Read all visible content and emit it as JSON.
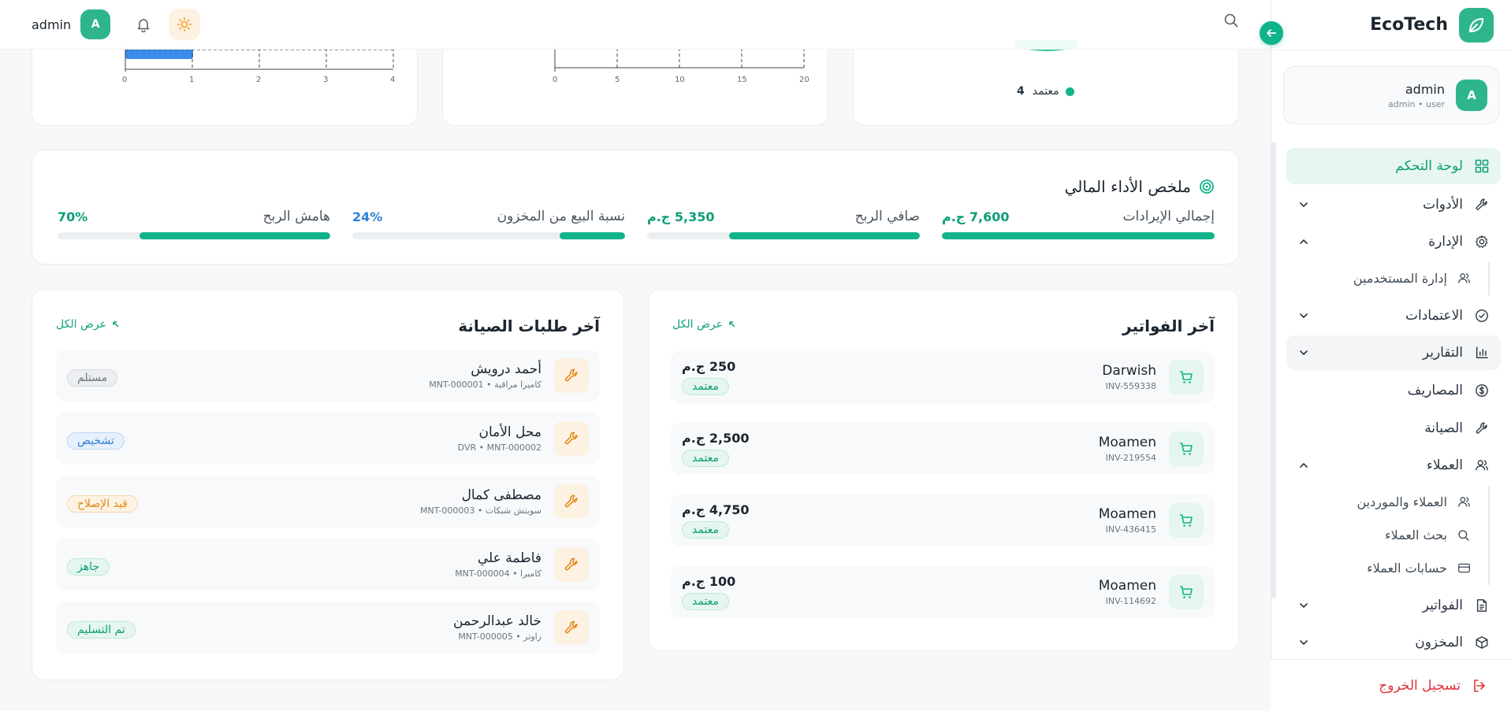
{
  "brand": {
    "name": "EcoTech"
  },
  "colors": {
    "accent": "#10b38a",
    "danger": "#e0333a",
    "blue": "#2f7fd8",
    "orange": "#e08a17"
  },
  "user": {
    "name": "admin",
    "role": "admin • user",
    "initial": "A"
  },
  "topbar": {
    "username": "admin",
    "initial": "A"
  },
  "sidebar": {
    "items": [
      {
        "label": "لوحة التحكم",
        "icon": "dashboard-icon"
      },
      {
        "label": "الأدوات",
        "icon": "wrench-icon"
      },
      {
        "label": "الإدارة",
        "icon": "gear-icon"
      },
      {
        "label": "إدارة المستخدمين",
        "icon": "users-icon"
      },
      {
        "label": "الاعتمادات",
        "icon": "check-circle-icon"
      },
      {
        "label": "التقارير",
        "icon": "bar-chart-icon"
      },
      {
        "label": "المصاريف",
        "icon": "dollar-icon"
      },
      {
        "label": "الصيانة",
        "icon": "wrench-icon"
      },
      {
        "label": "العملاء",
        "icon": "users-icon"
      },
      {
        "label": "العملاء والموردين",
        "icon": "users-icon"
      },
      {
        "label": "بحث العملاء",
        "icon": "search-icon"
      },
      {
        "label": "حسابات العملاء",
        "icon": "card-icon"
      },
      {
        "label": "الفواتير",
        "icon": "invoice-icon"
      },
      {
        "label": "المخزون",
        "icon": "box-icon"
      }
    ],
    "logout": "تسجيل الخروج"
  },
  "top_cards": {
    "chart1_ticks": [
      "0",
      "1",
      "2",
      "3",
      "4"
    ],
    "chart2_ticks": [
      "0",
      "5",
      "10",
      "15",
      "20"
    ],
    "legend": {
      "label": "معتمد",
      "value": "4"
    }
  },
  "financial": {
    "title": "ملخص الأداء المالي",
    "metrics": [
      {
        "label": "إجمالي الإيرادات",
        "value": "7,600 ج.م",
        "fill": 1.0,
        "color": "#10b38a"
      },
      {
        "label": "صافي الربح",
        "value": "5,350 ج.م",
        "fill": 0.7,
        "color": "#10b38a"
      },
      {
        "label": "نسبة البيع من المخزون",
        "value": "24%",
        "fill": 0.24,
        "color": "#10b38a"
      },
      {
        "label": "هامش الربح",
        "value": "70%",
        "fill": 0.7,
        "color": "#10b38a"
      }
    ]
  },
  "invoices": {
    "title": "آخر الفواتير",
    "view_all": "عرض الكل",
    "rows": [
      {
        "name": "Darwish",
        "id": "INV-559338",
        "amount": "250 ج.م",
        "status": "معتمد"
      },
      {
        "name": "Moamen",
        "id": "INV-219554",
        "amount": "2,500 ج.م",
        "status": "معتمد"
      },
      {
        "name": "Moamen",
        "id": "INV-436415",
        "amount": "4,750 ج.م",
        "status": "معتمد"
      },
      {
        "name": "Moamen",
        "id": "INV-114692",
        "amount": "100 ج.م",
        "status": "معتمد"
      }
    ]
  },
  "maintenance": {
    "title": "آخر طلبات الصيانة",
    "view_all": "عرض الكل",
    "rows": [
      {
        "name": "أحمد درويش",
        "sub": "كاميرا مراقبة • MNT-000001",
        "status": "مستلم"
      },
      {
        "name": "محل الأمان",
        "sub": "DVR • MNT-000002",
        "status": "تشخيص"
      },
      {
        "name": "مصطفى كمال",
        "sub": "سويتش شبكات • MNT-000003",
        "status": "قيد الإصلاح"
      },
      {
        "name": "فاطمة علي",
        "sub": "كاميرا • MNT-000004",
        "status": "جاهز"
      },
      {
        "name": "خالد عبدالرحمن",
        "sub": "راوتر • MNT-000005",
        "status": "تم التسليم"
      }
    ]
  }
}
